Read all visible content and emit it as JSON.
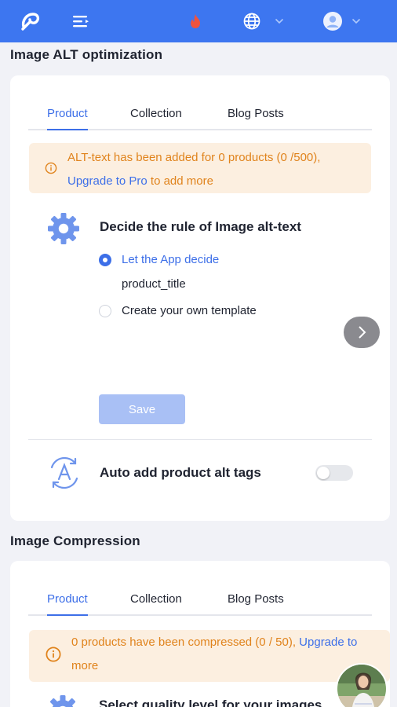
{
  "header": {
    "logo_icon": "app-logo-icon",
    "menu_icon": "menu-icon",
    "notification_icon": "fire-icon",
    "language_icon": "globe-icon",
    "account_icon": "user-avatar-icon",
    "bar_color": "#3d76f0"
  },
  "alt_section": {
    "title": "Image ALT optimization",
    "tabs": [
      {
        "label": "Product",
        "active": true
      },
      {
        "label": "Collection",
        "active": false
      },
      {
        "label": "Blog Posts",
        "active": false
      }
    ],
    "notice": {
      "text": "ALT-text has been added for 0 products (0 /500),",
      "link_label": "Upgrade to Pro",
      "suffix": "to add more"
    },
    "rule": {
      "title": "Decide the rule of Image alt-text",
      "options": [
        {
          "label": "Let the App decide",
          "selected": true
        },
        {
          "label": "Create your own template",
          "selected": false
        }
      ],
      "template_value": "product_title"
    },
    "save_label": "Save",
    "auto_tags": {
      "label": "Auto add product alt tags",
      "enabled": false
    }
  },
  "compression_section": {
    "title": "Image Compression",
    "tabs": [
      {
        "label": "Product",
        "active": true
      },
      {
        "label": "Collection",
        "active": false
      },
      {
        "label": "Blog Posts",
        "active": false
      }
    ],
    "notice": {
      "text": "0 products have been compressed (0 / 50),",
      "link_label": "Upgrade to",
      "suffix": "more"
    },
    "quality_title": "Select quality level for your images"
  },
  "colors": {
    "accent": "#3d6fe8",
    "warning_text": "#e0831c",
    "warning_bg": "#fcefe0"
  }
}
